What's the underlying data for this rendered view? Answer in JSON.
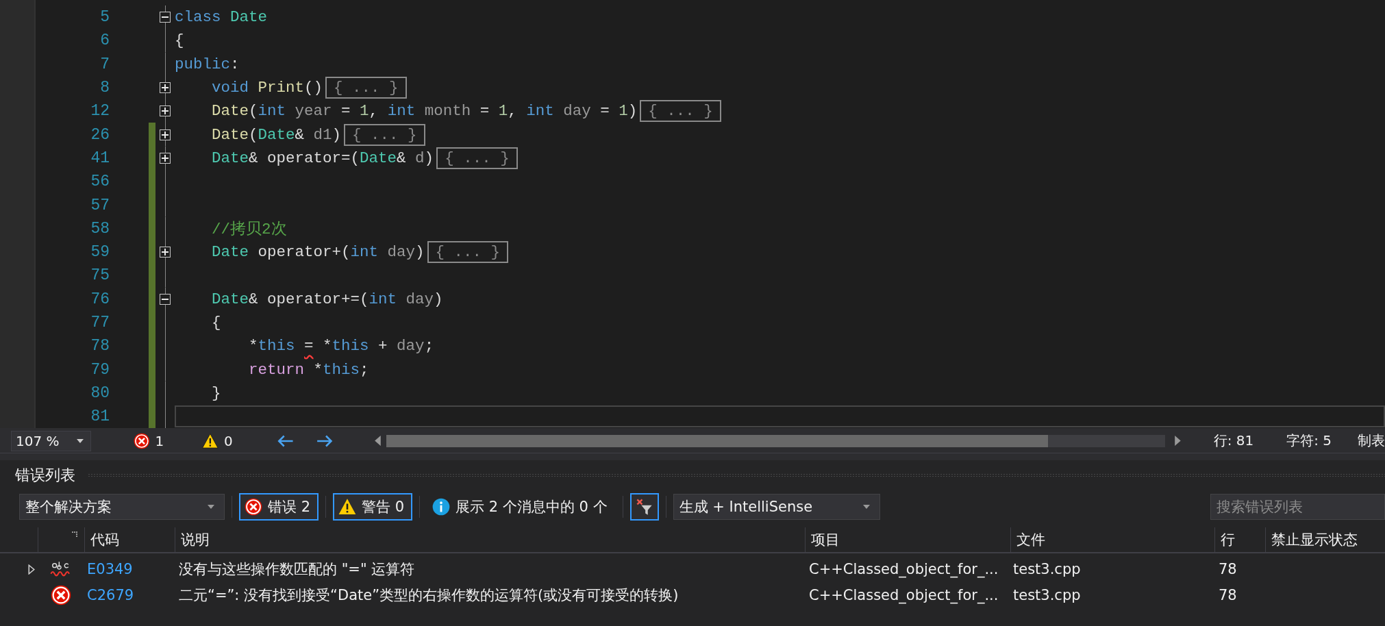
{
  "editor": {
    "lines": [
      {
        "number": "5",
        "changed": false,
        "folded": false,
        "tokens": [
          {
            "kind": "kw",
            "text": "class"
          },
          {
            "kind": "type",
            "text": " Date"
          }
        ]
      },
      {
        "number": "6",
        "changed": false,
        "tokens": [
          {
            "kind": "plain",
            "text": "{"
          }
        ]
      },
      {
        "number": "7",
        "changed": false,
        "tokens": [
          {
            "kind": "kw",
            "text": "public"
          },
          {
            "kind": "plain",
            "text": ":"
          }
        ]
      },
      {
        "number": "8",
        "changed": false,
        "folded": true,
        "tokens": [
          {
            "kind": "kw",
            "text": "    void"
          },
          {
            "kind": "fn",
            "text": " Print"
          },
          {
            "kind": "plain",
            "text": "()"
          }
        ],
        "collapsed": "{ ... }"
      },
      {
        "number": "12",
        "changed": false,
        "folded": true,
        "tokens": [
          {
            "kind": "fn",
            "text": "    Date"
          },
          {
            "kind": "plain",
            "text": "("
          },
          {
            "kind": "kw",
            "text": "int"
          },
          {
            "kind": "param",
            "text": " year"
          },
          {
            "kind": "plain",
            "text": " = "
          },
          {
            "kind": "num",
            "text": "1"
          },
          {
            "kind": "plain",
            "text": ", "
          },
          {
            "kind": "kw",
            "text": "int"
          },
          {
            "kind": "param",
            "text": " month"
          },
          {
            "kind": "plain",
            "text": " = "
          },
          {
            "kind": "num",
            "text": "1"
          },
          {
            "kind": "plain",
            "text": ", "
          },
          {
            "kind": "kw",
            "text": "int"
          },
          {
            "kind": "param",
            "text": " day"
          },
          {
            "kind": "plain",
            "text": " = "
          },
          {
            "kind": "num",
            "text": "1"
          },
          {
            "kind": "plain",
            "text": ")"
          }
        ],
        "collapsed": "{ ... }"
      },
      {
        "number": "26",
        "changed": true,
        "folded": true,
        "tokens": [
          {
            "kind": "fn",
            "text": "    Date"
          },
          {
            "kind": "plain",
            "text": "("
          },
          {
            "kind": "type",
            "text": "Date"
          },
          {
            "kind": "plain",
            "text": "& "
          },
          {
            "kind": "param",
            "text": "d1"
          },
          {
            "kind": "plain",
            "text": ")"
          }
        ],
        "collapsed": "{ ... }"
      },
      {
        "number": "41",
        "changed": true,
        "folded": true,
        "tokens": [
          {
            "kind": "type",
            "text": "    Date"
          },
          {
            "kind": "plain",
            "text": "& operator=("
          },
          {
            "kind": "type",
            "text": "Date"
          },
          {
            "kind": "plain",
            "text": "& "
          },
          {
            "kind": "param",
            "text": "d"
          },
          {
            "kind": "plain",
            "text": ")"
          }
        ],
        "collapsed": "{ ... }"
      },
      {
        "number": "56",
        "changed": true
      },
      {
        "number": "57",
        "changed": true
      },
      {
        "number": "58",
        "changed": true,
        "tokens": [
          {
            "kind": "comment",
            "text": "    //拷贝2次"
          }
        ]
      },
      {
        "number": "59",
        "changed": true,
        "folded": true,
        "tokens": [
          {
            "kind": "type",
            "text": "    Date"
          },
          {
            "kind": "plain",
            "text": " operator+("
          },
          {
            "kind": "kw",
            "text": "int"
          },
          {
            "kind": "param",
            "text": " day"
          },
          {
            "kind": "plain",
            "text": ")"
          }
        ],
        "collapsed": "{ ... }"
      },
      {
        "number": "75",
        "changed": true
      },
      {
        "number": "76",
        "changed": true,
        "folded": false,
        "tokens": [
          {
            "kind": "type",
            "text": "    Date"
          },
          {
            "kind": "plain",
            "text": "& operator+=("
          },
          {
            "kind": "kw",
            "text": "int"
          },
          {
            "kind": "param",
            "text": " day"
          },
          {
            "kind": "plain",
            "text": ")"
          }
        ]
      },
      {
        "number": "77",
        "changed": true,
        "tokens": [
          {
            "kind": "plain",
            "text": "    {"
          }
        ]
      },
      {
        "number": "78",
        "changed": true,
        "tokens": [
          {
            "kind": "plain",
            "text": "        *"
          },
          {
            "kind": "kw",
            "text": "this "
          },
          {
            "kind": "plain",
            "text": "=",
            "squiggle": true
          },
          {
            "kind": "plain",
            "text": " *"
          },
          {
            "kind": "kw",
            "text": "this"
          },
          {
            "kind": "plain",
            "text": " +"
          },
          {
            "kind": "param",
            "text": " day"
          },
          {
            "kind": "plain",
            "text": ";"
          }
        ]
      },
      {
        "number": "79",
        "changed": true,
        "tokens": [
          {
            "kind": "ctrl",
            "text": "        return"
          },
          {
            "kind": "plain",
            "text": " *"
          },
          {
            "kind": "kw",
            "text": "this"
          },
          {
            "kind": "plain",
            "text": ";"
          }
        ]
      },
      {
        "number": "80",
        "changed": true,
        "tokens": [
          {
            "kind": "plain",
            "text": "    }"
          }
        ]
      },
      {
        "number": "81",
        "changed": true,
        "current": true
      }
    ]
  },
  "status_bar": {
    "zoom": "107 %",
    "errors": "1",
    "warnings": "0",
    "line": "行: 81",
    "column": "字符: 5",
    "tabs": "制表"
  },
  "error_list": {
    "title": "错误列表",
    "scope": "整个解决方案",
    "filters": [
      {
        "kind": "error",
        "label": "错误 2",
        "selected": true
      },
      {
        "kind": "warning",
        "label": "警告 0",
        "selected": true
      },
      {
        "kind": "info",
        "label": "展示 2 个消息中的 0 个",
        "selected": false
      }
    ],
    "filter_toggle_selected": true,
    "source": "生成 + IntelliSense",
    "search": {
      "placeholder": "搜索错误列表"
    },
    "columns": [
      "代码",
      "说明",
      "项目",
      "文件",
      "行",
      "禁止显示状态"
    ],
    "rows": [
      {
        "kind": "intellisense",
        "expandable": true,
        "code": "E0349",
        "description": "没有与这些操作数匹配的 \"=\" 运算符",
        "project": "C++Classed_object_for_...",
        "file": "test3.cpp",
        "line": "78"
      },
      {
        "kind": "error",
        "expandable": false,
        "code": "C2679",
        "description": "二元“=”: 没有找到接受“Date”类型的右操作数的运算符(或没有可接受的转换)",
        "project": "C++Classed_object_for_...",
        "file": "test3.cpp",
        "line": "78"
      }
    ]
  }
}
